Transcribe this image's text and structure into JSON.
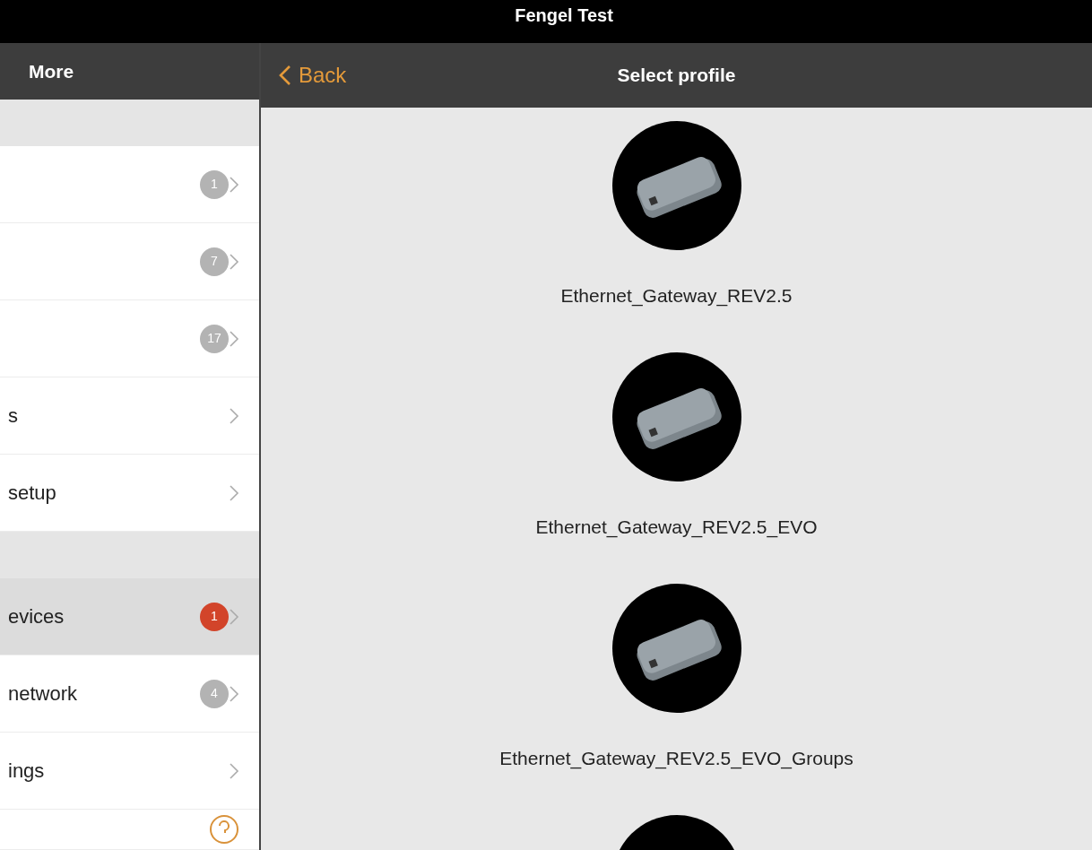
{
  "window": {
    "title": "Fengel Test"
  },
  "sidebar": {
    "title": "More",
    "sections": [
      {
        "items": [
          {
            "badge": "1",
            "color": "#b3b3b3",
            "selected": false,
            "kind": "chevron"
          },
          {
            "badge": "7",
            "color": "#b3b3b3",
            "selected": false,
            "kind": "chevron"
          },
          {
            "badge": "17",
            "color": "#b3b3b3",
            "selected": false,
            "kind": "chevron"
          },
          {
            "label": "s",
            "selected": false,
            "kind": "chevron"
          },
          {
            "label": "setup",
            "selected": false,
            "kind": "chevron"
          }
        ]
      },
      {
        "items": [
          {
            "label": "evices",
            "badge": "1",
            "color": "#d2442a",
            "selected": true,
            "kind": "chevron"
          },
          {
            "label": "network",
            "badge": "4",
            "color": "#b3b3b3",
            "selected": false,
            "kind": "chevron"
          },
          {
            "label": "ings",
            "selected": false,
            "kind": "chevron"
          },
          {
            "selected": false,
            "kind": "help"
          }
        ]
      }
    ]
  },
  "detail": {
    "back": "Back",
    "title": "Select profile",
    "profiles": [
      {
        "kind": "device",
        "name": "Ethernet_Gateway_REV2.5"
      },
      {
        "kind": "device",
        "name": "Ethernet_Gateway_REV2.5_EVO"
      },
      {
        "kind": "device",
        "name": "Ethernet_Gateway_REV2.5_EVO_Groups"
      },
      {
        "kind": "device"
      }
    ]
  }
}
